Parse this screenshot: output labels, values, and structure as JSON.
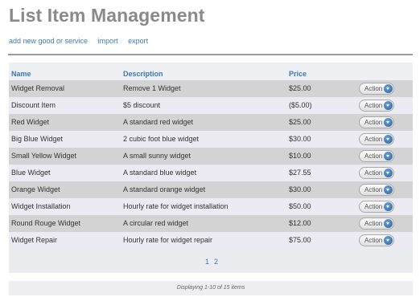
{
  "page": {
    "title": "List Item Management",
    "links": [
      "add new good or service",
      "import",
      "export"
    ]
  },
  "table": {
    "headers": {
      "name": "Name",
      "description": "Description",
      "price": "Price"
    },
    "action_label": "Action",
    "rows": [
      {
        "name": "Widget Removal",
        "description": "Remove 1 Widget",
        "price": "$25.00"
      },
      {
        "name": "Discount Item",
        "description": "$5 discount",
        "price": "($5.00)"
      },
      {
        "name": "Red Widget",
        "description": "A standard red widget",
        "price": "$25.00"
      },
      {
        "name": "Big Blue Widget",
        "description": "2 cubic foot blue widget",
        "price": "$30.00"
      },
      {
        "name": "Small Yellow Widget",
        "description": "A small sunny widget",
        "price": "$10.00"
      },
      {
        "name": "Blue Widget",
        "description": "A standard blue widget",
        "price": "$27.55"
      },
      {
        "name": "Orange Widget",
        "description": "A standard orange widget",
        "price": "$30.00"
      },
      {
        "name": "Widget Installation",
        "description": "Hourly rate for widget installation",
        "price": "$50.00"
      },
      {
        "name": "Round Rouge Widget",
        "description": "A circular red widget",
        "price": "$12.00"
      },
      {
        "name": "Widget Repair",
        "description": "Hourly rate for widget repair",
        "price": "$75.00"
      }
    ],
    "pages": [
      "1",
      "2"
    ],
    "status": "Displaying 1-10 of 15 items"
  },
  "colors": {
    "link": "#3a7ab8",
    "row_odd": "#d3d3d3",
    "row_even": "#ecebf3",
    "title": "#8a8a8a"
  },
  "icons": {
    "action_dropdown": "chevron-down-icon"
  }
}
